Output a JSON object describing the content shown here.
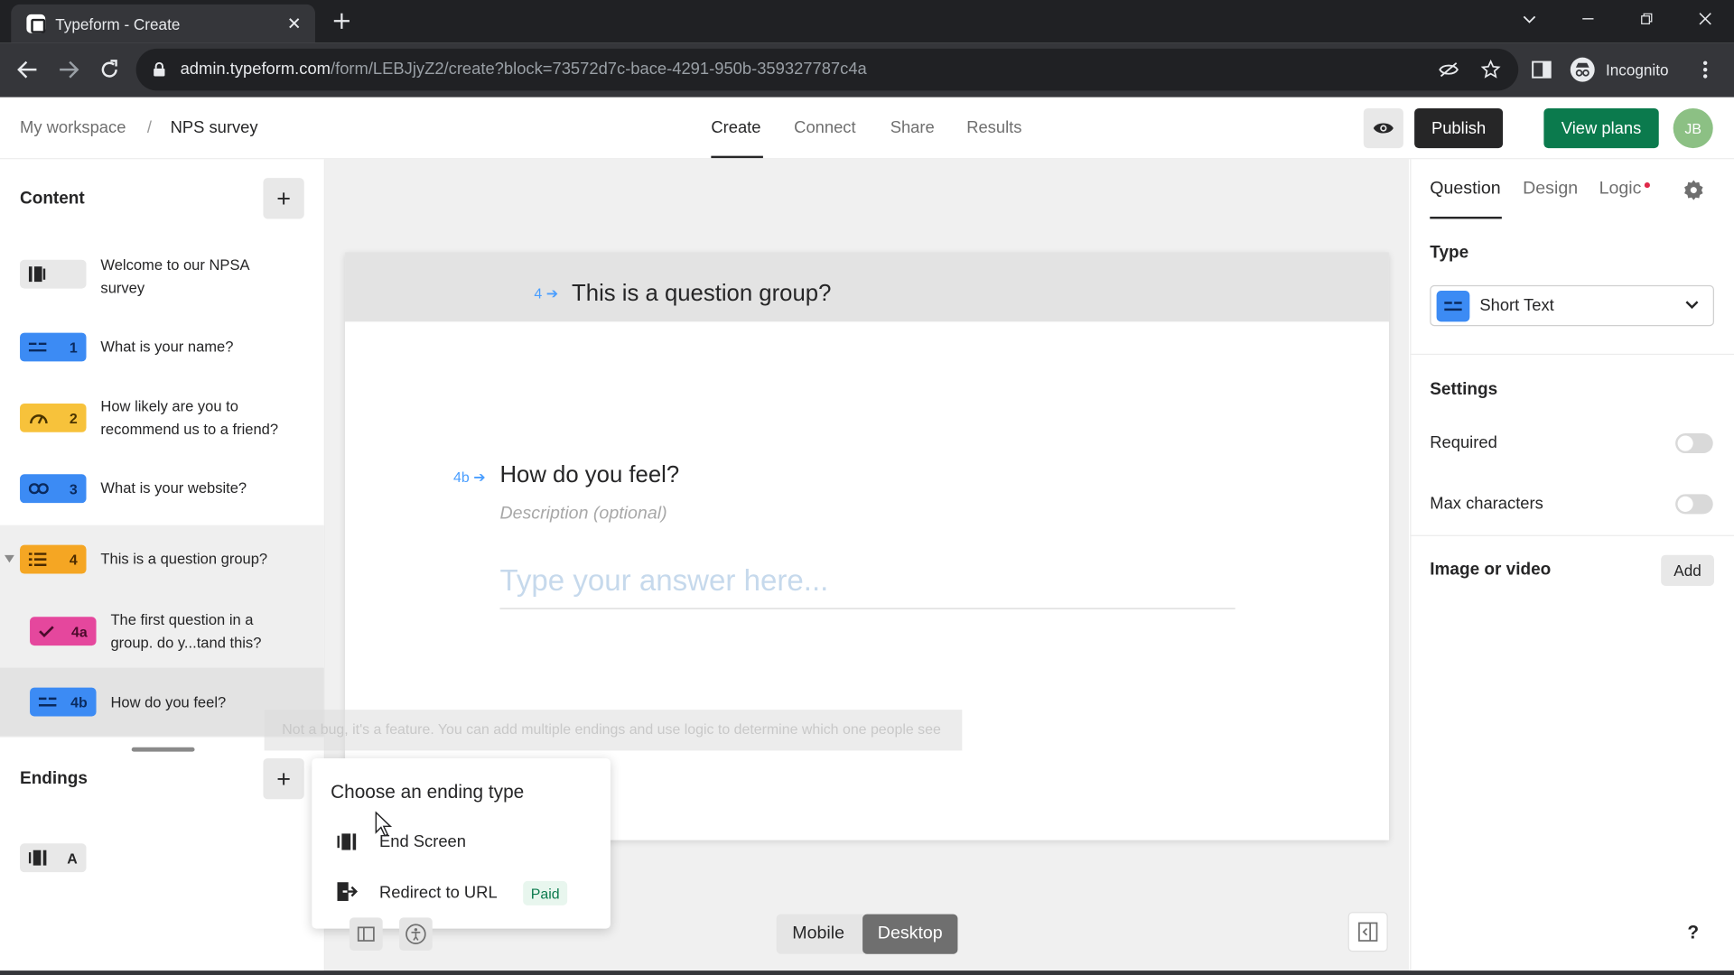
{
  "browser": {
    "tab_title": "Typeform - Create",
    "url_host": "admin.typeform.com",
    "url_path": "/form/LEBJjyZ2/create?block=73572d7c-bace-4291-950b-359327787c4a",
    "incognito_label": "Incognito"
  },
  "header": {
    "workspace": "My workspace",
    "separator": "/",
    "form_name": "NPS survey",
    "tabs": [
      "Create",
      "Connect",
      "Share",
      "Results"
    ],
    "publish_label": "Publish",
    "view_plans_label": "View plans",
    "avatar_initials": "JB"
  },
  "sidebar": {
    "content_title": "Content",
    "items": [
      {
        "badge": "",
        "text": "Welcome to our NPSA survey",
        "color": "#e8e8e8"
      },
      {
        "badge": "1",
        "text": "What is your name?",
        "color": "#3c8bf4"
      },
      {
        "badge": "2",
        "text": "How likely are you to recommend us to a friend?",
        "color": "#f7c23b"
      },
      {
        "badge": "3",
        "text": "What is your website?",
        "color": "#3c8bf4"
      },
      {
        "badge": "4",
        "text": "This is a question group?",
        "color": "#f5a623"
      },
      {
        "badge": "4a",
        "text": "The first question in a group. do y...tand this?",
        "color": "#e5479d"
      },
      {
        "badge": "4b",
        "text": "How do you feel?",
        "color": "#3c8bf4"
      }
    ],
    "endings_title": "Endings",
    "ending_item_label": "A"
  },
  "canvas": {
    "group_number": "4",
    "group_title": "This is a question group?",
    "question_number": "4b",
    "question_title": "How do you feel?",
    "description_placeholder": "Description (optional)",
    "answer_placeholder": "Type your answer here...",
    "hint_text": "Not a bug, it's a feature. You can add multiple endings and use logic to determine which one people see",
    "device_mobile": "Mobile",
    "device_desktop": "Desktop"
  },
  "ending_popover": {
    "title": "Choose an ending type",
    "options": [
      "End Screen",
      "Redirect to URL"
    ],
    "paid_badge": "Paid"
  },
  "panel": {
    "tabs": [
      "Question",
      "Design",
      "Logic"
    ],
    "type_label": "Type",
    "type_value": "Short Text",
    "settings_label": "Settings",
    "required_label": "Required",
    "required_on": false,
    "max_chars_label": "Max characters",
    "max_chars_on": false,
    "image_label": "Image or video",
    "add_label": "Add",
    "help_label": "?"
  }
}
